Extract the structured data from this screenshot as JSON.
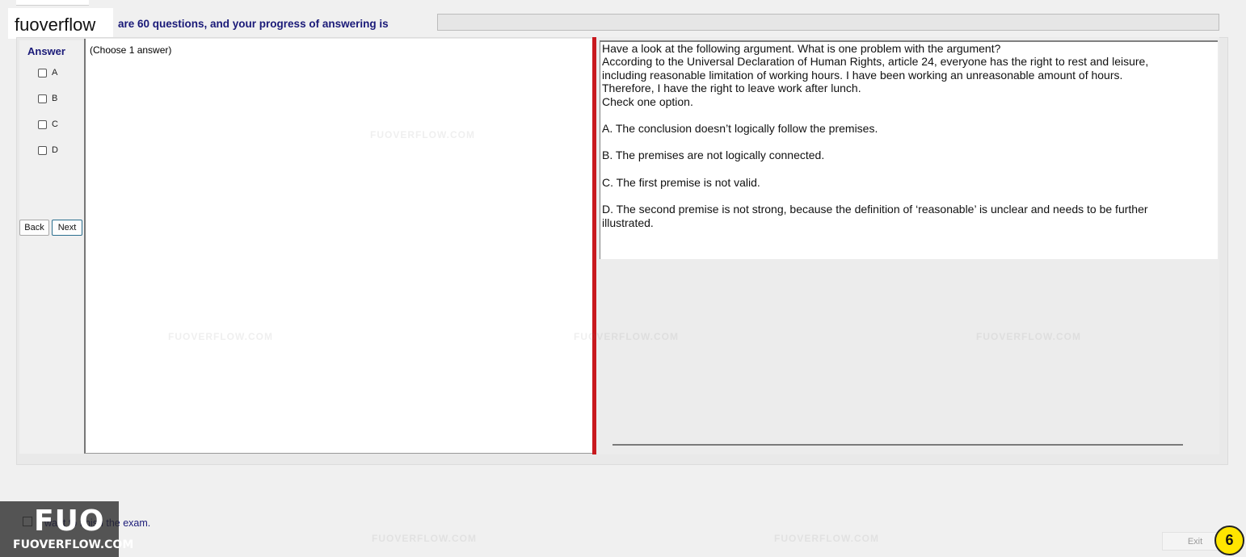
{
  "brand": {
    "name": "fuoverflow"
  },
  "header": {
    "progress_text": "are 60 questions, and your progress of answering is",
    "progress_fraction": 0
  },
  "answer": {
    "title": "Answer",
    "options": [
      "A",
      "B",
      "C",
      "D"
    ]
  },
  "navigation": {
    "back_label": "Back",
    "next_label": "Next"
  },
  "choose_label": "(Choose 1 answer)",
  "question": {
    "lines": [
      "Have a look at the following argument. What is one problem with the argument?",
      "According to the Universal Declaration of Human Rights, article 24, everyone has the right to rest and leisure,",
      "including reasonable limitation of working hours. I have been working an unreasonable amount of hours.",
      "Therefore, I have the right to leave work after lunch.",
      "Check one option."
    ],
    "options": [
      "A.  The conclusion doesn’t logically follow the premises.",
      "B.  The premises are not logically connected.",
      "C.  The first premise is not valid.",
      "D.  The second premise is not strong, because the definition of ‘reasonable’ is unclear and needs to be further illustrated."
    ]
  },
  "footer": {
    "finish_text": "I want to finish the exam.",
    "exit_label": "Exit",
    "logo_big": "FUO",
    "logo_small": "FUOVERFLOW.COM",
    "badge_number": "6"
  },
  "watermark": "FUOVERFLOW.COM",
  "colors": {
    "accent_text": "#1a1a78",
    "divider": "#c8191e",
    "badge": "#ffe500"
  }
}
